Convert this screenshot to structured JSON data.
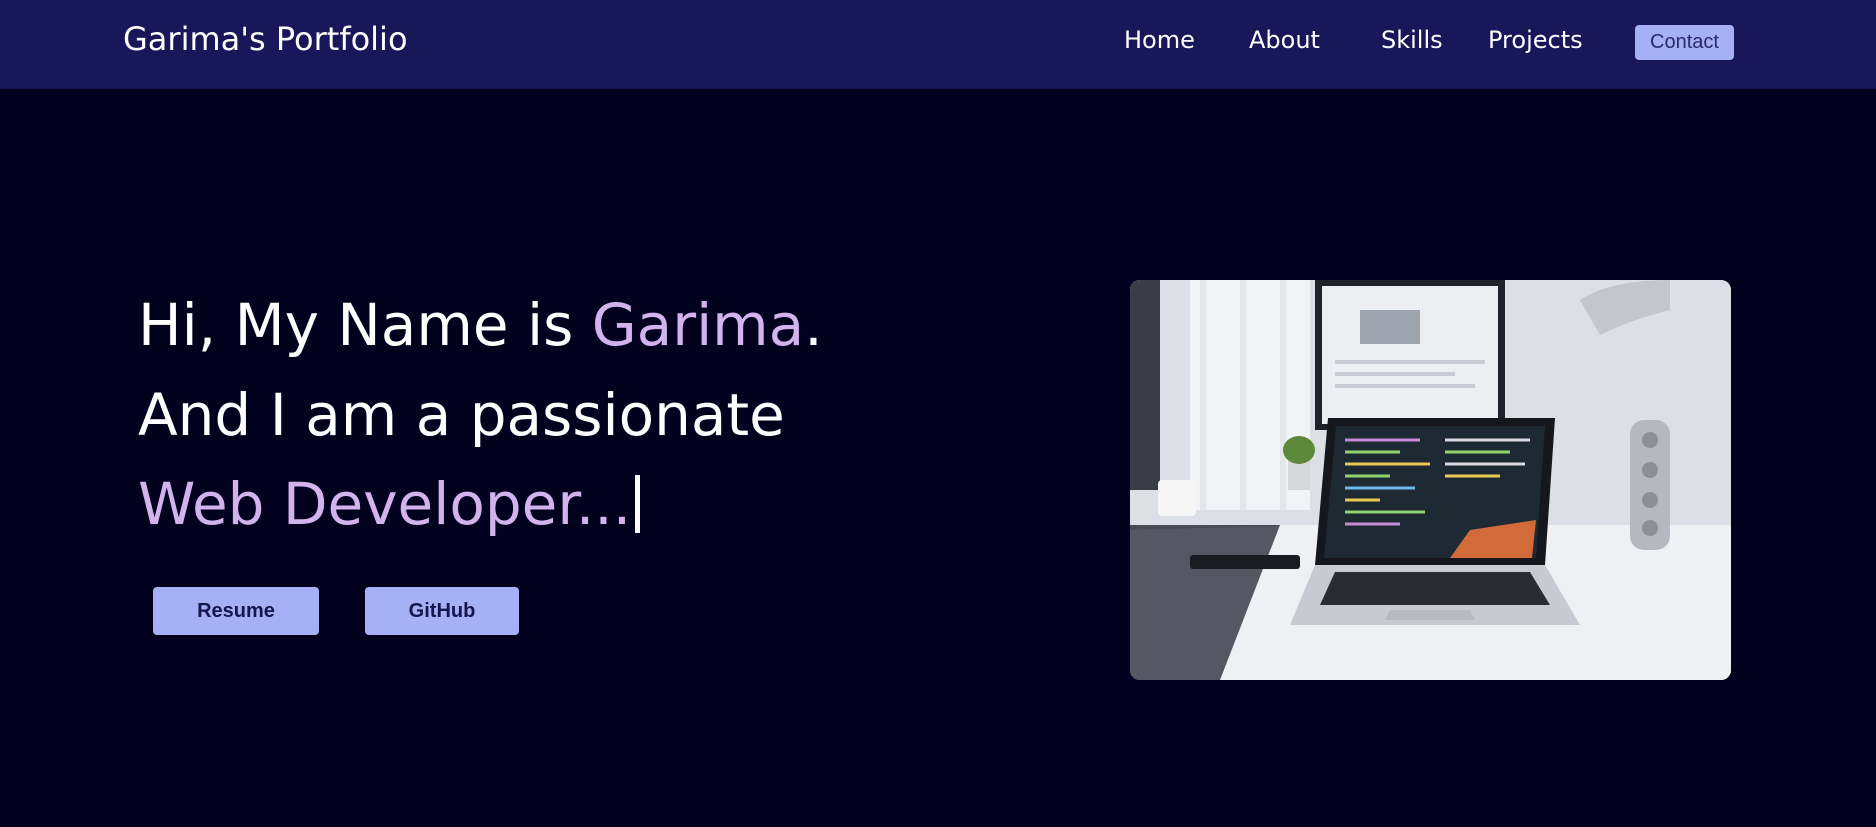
{
  "navbar": {
    "brand": "Garima's Portfolio",
    "links": [
      {
        "label": "Home"
      },
      {
        "label": "About"
      },
      {
        "label": "Skills"
      },
      {
        "label": "Projects"
      }
    ],
    "contact_label": "Contact"
  },
  "hero": {
    "line1_prefix": "Hi, My Name is ",
    "name": "Garima",
    "line1_suffix": ".",
    "line2": "And I am a passionate",
    "typed_text": "Web Developer...",
    "buttons": {
      "resume_label": "Resume",
      "github_label": "GitHub"
    }
  },
  "colors": {
    "background": "#02011e",
    "navbar": "#17175a",
    "accent_text": "#d3b3ec",
    "button": "#a5b1f4"
  },
  "icons": {
    "hero_image": "laptop-desk-photo"
  }
}
